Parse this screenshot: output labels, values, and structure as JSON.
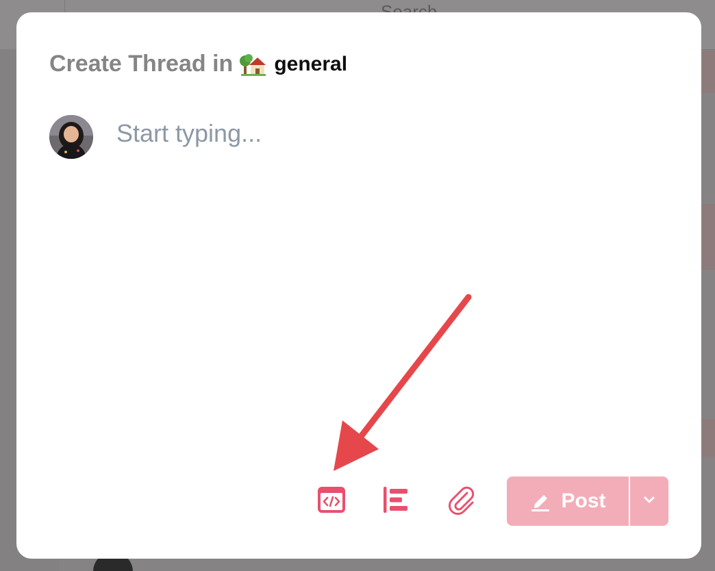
{
  "background": {
    "search_label": "Search"
  },
  "modal": {
    "title_prefix": "Create Thread in",
    "channel_emoji": "house-with-garden-icon",
    "channel_name": "general",
    "composer_placeholder": "Start typing..."
  },
  "toolbar": {
    "code_icon": "code-block-icon",
    "outline_icon": "text-align-left-icon",
    "attach_icon": "paperclip-icon",
    "post_label": "Post",
    "post_icon": "pencil-icon",
    "menu_icon": "chevron-down-icon"
  },
  "colors": {
    "accent": "#e8506e",
    "post_button": "#f3adb9",
    "arrow": "#e6474b",
    "title": "#858585",
    "placeholder": "#8c98a5"
  }
}
